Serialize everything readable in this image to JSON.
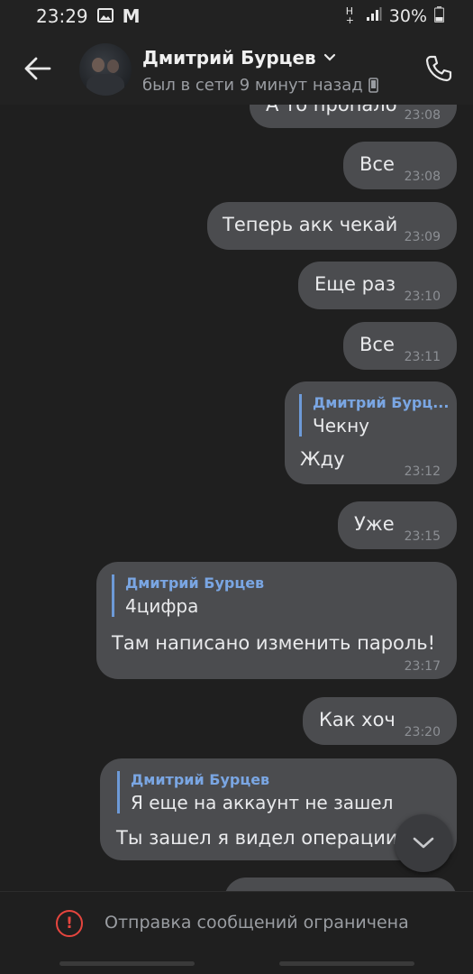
{
  "status_bar": {
    "time": "23:29",
    "mail_letter": "M",
    "network": "H+",
    "battery": "30%"
  },
  "header": {
    "contact_name": "Дмитрий Бурцев",
    "last_seen": "был в сети 9 минут назад"
  },
  "messages": [
    {
      "text": "А то пропало",
      "time": "23:08"
    },
    {
      "text": "Все",
      "time": "23:08"
    },
    {
      "text": "Теперь акк чекай",
      "time": "23:09"
    },
    {
      "text": "Еще раз",
      "time": "23:10"
    },
    {
      "text": "Все",
      "time": "23:11"
    },
    {
      "reply_name": "Дмитрий Бурц...",
      "reply_text": "Чекну",
      "text": "Жду",
      "time": "23:12"
    },
    {
      "text": "Уже",
      "time": "23:15"
    },
    {
      "reply_name": "Дмитрий Бурцев",
      "reply_text": "4цифра",
      "text": "Там написано изменить пароль!",
      "time": "23:17"
    },
    {
      "text": "Как хоч",
      "time": "23:20"
    },
    {
      "reply_name": "Дмитрий Бурцев",
      "reply_text": "Я еще на аккаунт не зашел",
      "text": "Ты зашел я видел операции",
      "time": ""
    }
  ],
  "footer": {
    "restriction_text": "Отправка сообщений ограничена"
  },
  "colors": {
    "background": "#1f1f1f",
    "bubble": "#4b4c4f",
    "reply_accent": "#7aa6e3",
    "warning": "#e5453e"
  }
}
